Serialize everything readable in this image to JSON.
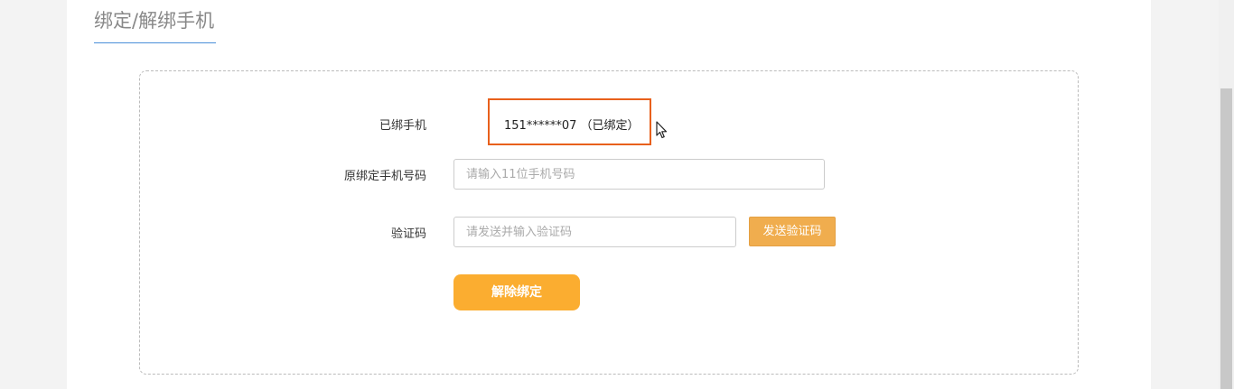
{
  "page": {
    "title": "绑定/解绑手机"
  },
  "form": {
    "bound_phone_label": "已绑手机",
    "bound_phone_value": "151******07 （已绑定）",
    "original_phone_label": "原绑定手机号码",
    "original_phone_placeholder": "请输入11位手机号码",
    "original_phone_value": "",
    "code_label": "验证码",
    "code_placeholder": "请发送并输入验证码",
    "code_value": "",
    "send_code_button": "发送验证码",
    "unbind_button": "解除绑定"
  },
  "colors": {
    "accent": "#fbad30",
    "send_button": "#f0ad4e",
    "highlight_box": "#e8601c",
    "title_underline": "#4a90d9"
  },
  "icons": {
    "cursor": "mouse-pointer-icon"
  }
}
